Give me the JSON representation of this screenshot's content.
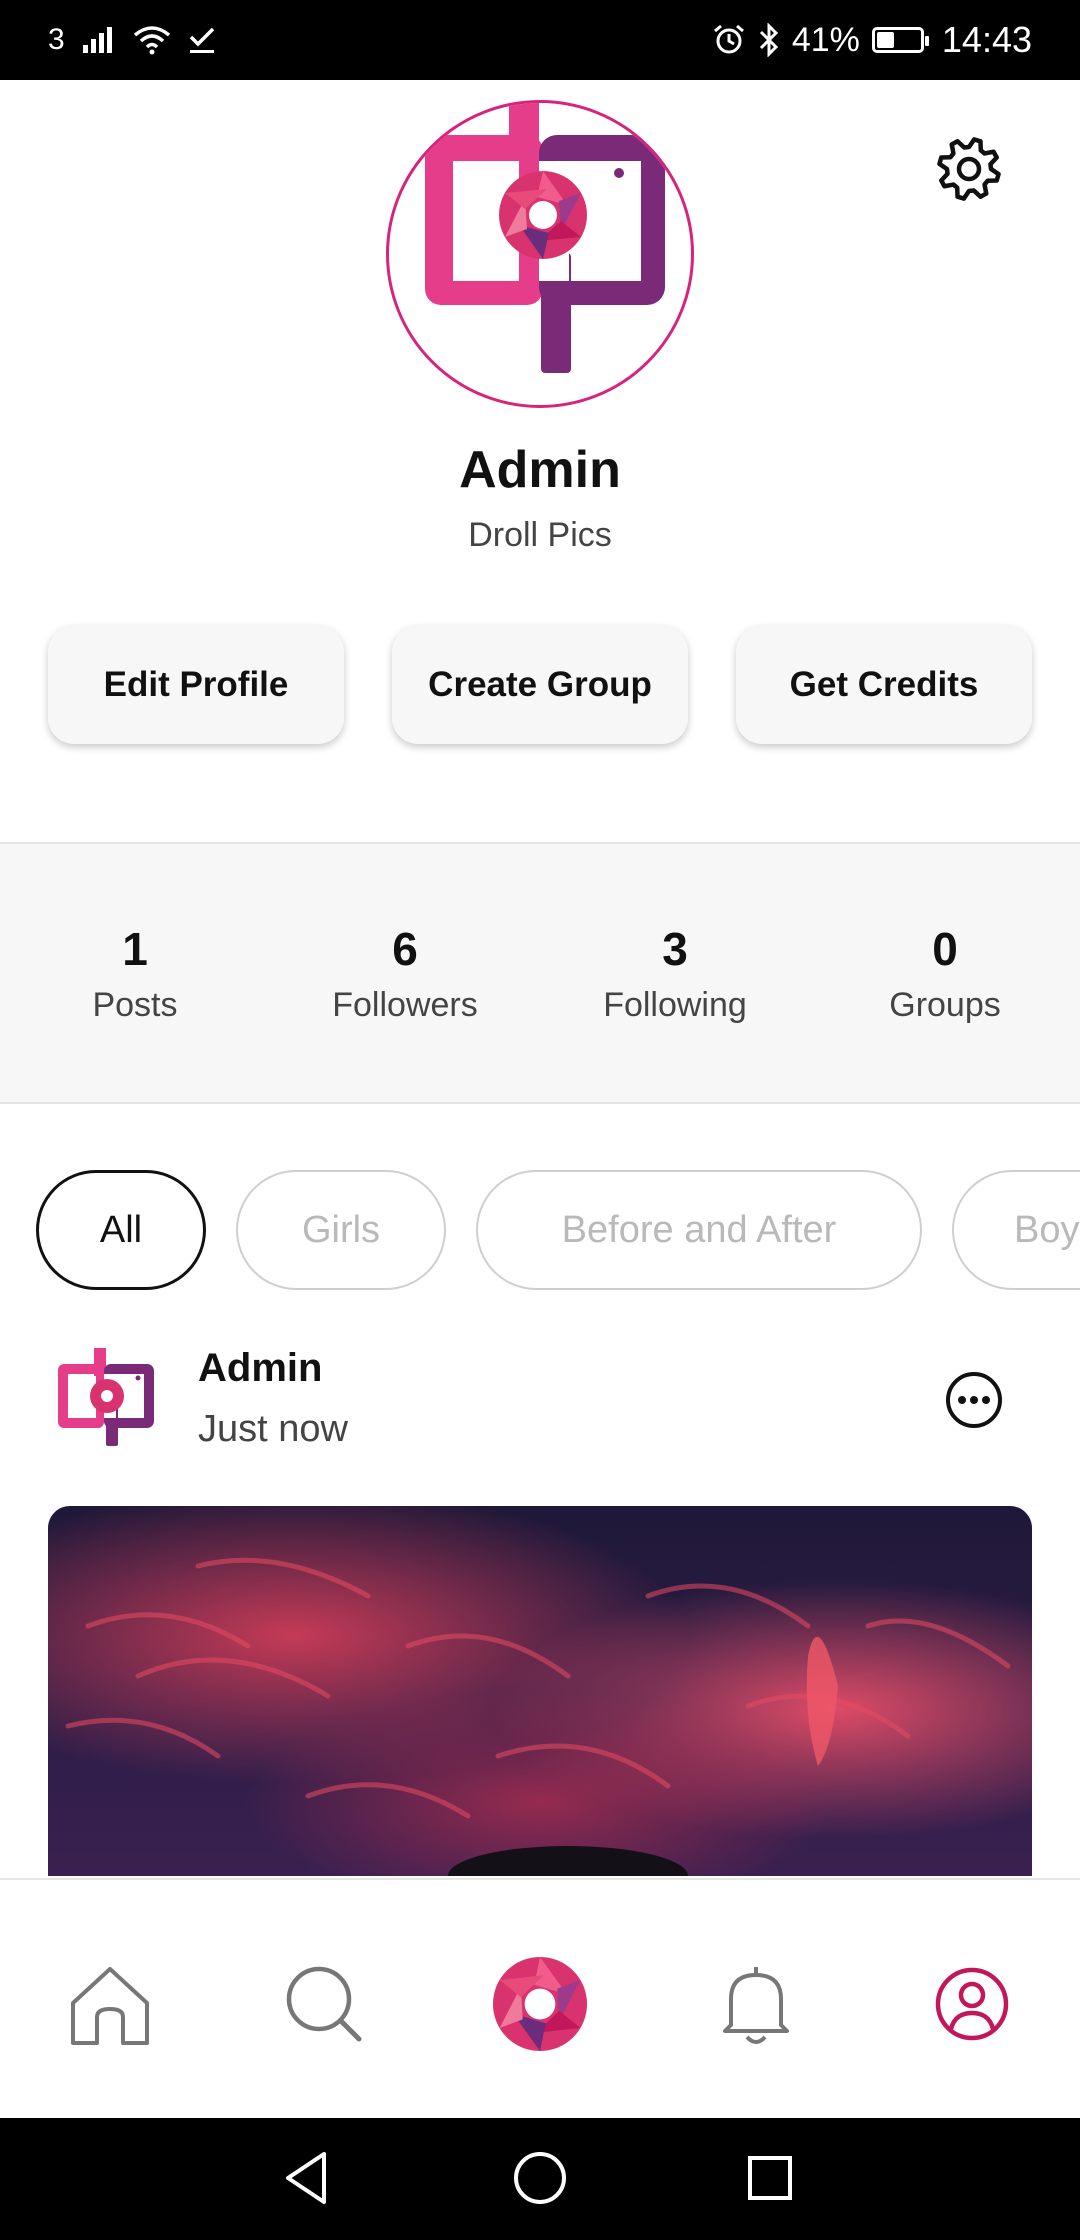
{
  "status_bar": {
    "carrier": "3",
    "battery_percent_text": "41%",
    "battery_level": 0.41,
    "time": "14:43",
    "icons": [
      "signal-icon",
      "wifi-icon",
      "check-icon",
      "alarm-icon",
      "bluetooth-icon",
      "battery-icon"
    ]
  },
  "profile": {
    "name": "Admin",
    "subtitle": "Droll Pics"
  },
  "actions": {
    "edit_profile": "Edit Profile",
    "create_group": "Create Group",
    "get_credits": "Get Credits"
  },
  "stats": [
    {
      "value": "1",
      "label": "Posts"
    },
    {
      "value": "6",
      "label": "Followers"
    },
    {
      "value": "3",
      "label": "Following"
    },
    {
      "value": "0",
      "label": "Groups"
    }
  ],
  "categories": [
    {
      "label": "All",
      "active": true
    },
    {
      "label": "Girls",
      "active": false
    },
    {
      "label": "Before and After",
      "active": false
    },
    {
      "label": "Boy",
      "active": false
    }
  ],
  "post": {
    "author": "Admin",
    "time": "Just now"
  },
  "bottom_nav": {
    "items": [
      "home-icon",
      "search-icon",
      "camera-shutter-icon",
      "bell-icon",
      "profile-icon"
    ],
    "active": "profile-icon"
  },
  "colors": {
    "brand_pink": "#e53d8a",
    "brand_purple": "#7b2a78",
    "active_nav": "#c2185b"
  }
}
